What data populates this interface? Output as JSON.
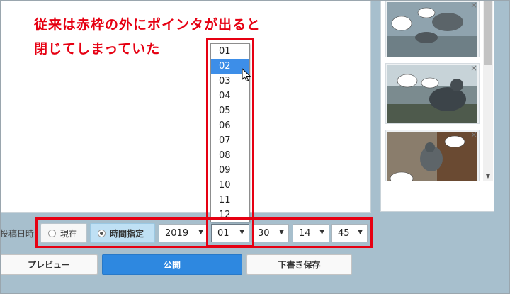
{
  "annotation": {
    "line1": "従来は赤枠の外にポインタが出ると",
    "line2": "閉じてしまっていた"
  },
  "schedule": {
    "label": "投稿日時",
    "radio_now": "現在",
    "radio_specify": "時間指定",
    "year": "2019",
    "month": "01",
    "day": "30",
    "hour": "14",
    "minute": "45"
  },
  "month_options": [
    "01",
    "02",
    "03",
    "04",
    "05",
    "06",
    "07",
    "08",
    "09",
    "10",
    "11",
    "12"
  ],
  "month_highlighted": "02",
  "buttons": {
    "preview": "プレビュー",
    "publish": "公開",
    "draft": "下書き保存"
  },
  "thumbnails": {
    "close_glyph": "×",
    "count": 3
  },
  "colors": {
    "annotation_red": "#e60012",
    "publish_blue": "#2e88e0",
    "highlight_blue": "#3d8ee8",
    "background": "#a7bfcd"
  },
  "icons": [
    "radio-icon",
    "dropdown-arrow-icon",
    "close-icon",
    "mouse-pointer-icon",
    "scroll-down-arrow-icon"
  ]
}
